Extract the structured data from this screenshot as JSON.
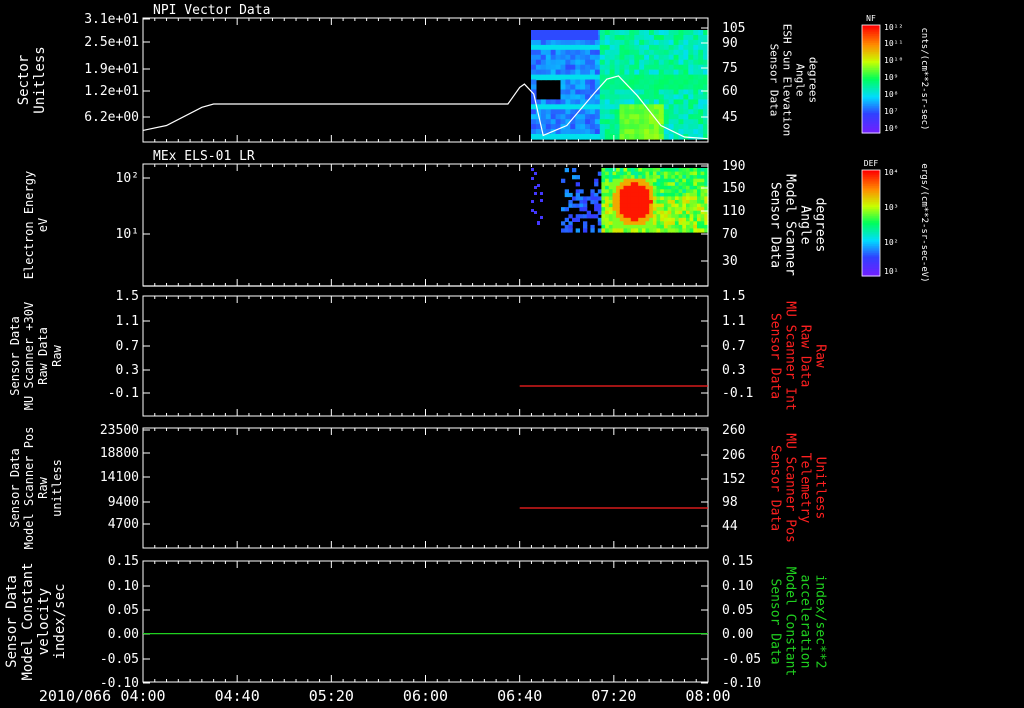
{
  "colors": {
    "background": "#000000",
    "axis": "#ffffff",
    "red": "#ff2020",
    "green": "#20d020"
  },
  "xaxis": {
    "date_label": "2010/066",
    "ticks": [
      "04:00",
      "04:40",
      "05:20",
      "06:00",
      "06:40",
      "07:20",
      "08:00"
    ]
  },
  "colorbars": [
    {
      "name": "NF",
      "top_label": "10¹²",
      "tick_labels": [
        "10¹¹",
        "10¹⁰",
        "10⁹",
        "10⁸",
        "10⁷",
        "10⁶"
      ],
      "units": "cnts/(cm**2-sr-sec)"
    },
    {
      "name": "DEF",
      "top_label": "10⁴",
      "tick_labels": [
        "10³",
        "10²",
        "10¹"
      ],
      "units": "ergs/(cm**2-sr-sec-eV)"
    }
  ],
  "chart_data": [
    {
      "type": "heatmap",
      "title": "NPI Vector Data",
      "ylabel": [
        "Sector",
        "Unitless"
      ],
      "ytick_labels": [
        "3.1e+01",
        "2.5e+01",
        "1.9e+01",
        "1.2e+01",
        "6.2e+00"
      ],
      "right_ylabel": [
        "Sensor Data",
        "ESH Sun Elevation",
        "Angle",
        "degrees"
      ],
      "right_ytick_labels": [
        "105",
        "90",
        "75",
        "60",
        "45"
      ],
      "right_ylim": [
        30,
        105
      ],
      "colorbar": "NF",
      "overlay_series": {
        "name": "ESH Sun Elevation Angle",
        "color": "#ffffff",
        "x": [
          "04:00",
          "04:10",
          "04:25",
          "04:30",
          "06:35",
          "06:40",
          "06:42",
          "06:46",
          "06:50",
          "07:00",
          "07:12",
          "07:17",
          "07:22",
          "07:30",
          "07:40",
          "07:50",
          "08:00"
        ],
        "y": [
          37,
          40,
          51,
          53,
          53,
          63,
          65,
          59,
          34,
          40,
          60,
          68,
          70,
          58,
          40,
          33,
          32
        ]
      }
    },
    {
      "type": "heatmap",
      "title": "MEx ELS-01 LR",
      "ylabel": [
        "Electron Energy",
        "eV"
      ],
      "ytick_labels": [
        "10²",
        "10¹"
      ],
      "ylog": true,
      "right_ylabel": [
        "Sensor Data",
        "Model Scanner",
        "Angle",
        "degrees"
      ],
      "right_ytick_labels": [
        "190",
        "150",
        "110",
        "70",
        "30"
      ],
      "right_ylim": [
        10,
        190
      ],
      "colorbar": "DEF",
      "overlay_series": {
        "name": "Model Scanner Angle",
        "color": "#ffffff",
        "x": [
          "04:00",
          "08:00"
        ],
        "y": [
          10,
          10
        ]
      }
    },
    {
      "type": "line",
      "ylabel": [
        "Sensor Data",
        "MU Scanner +30V",
        "Raw Data",
        "Raw"
      ],
      "ytick_labels": [
        "1.5",
        "1.1",
        "0.7",
        "0.3",
        "-0.1"
      ],
      "ylim": [
        -0.5,
        1.5
      ],
      "right_ylabel": [
        "Sensor Data",
        "MU Scanner Int",
        "Raw Data",
        "Raw"
      ],
      "right_ytick_labels": [
        "1.5",
        "1.1",
        "0.7",
        "0.3",
        "-0.1"
      ],
      "right_ylim": [
        -0.5,
        1.5
      ],
      "series": [
        {
          "color": "#ff2020",
          "axis": "right",
          "x": [
            "06:40",
            "08:00"
          ],
          "y": [
            0,
            0
          ]
        }
      ]
    },
    {
      "type": "line",
      "ylabel": [
        "Sensor Data",
        "Model Scanner Pos",
        "Raw",
        "unitless"
      ],
      "ytick_labels": [
        "23500",
        "18800",
        "14100",
        "9400",
        "4700"
      ],
      "ylim": [
        0,
        23500
      ],
      "right_ylabel": [
        "Sensor Data",
        "MU Scanner Pos",
        "Telemetry",
        "Unitless"
      ],
      "right_ytick_labels": [
        "260",
        "206",
        "152",
        "98",
        "44"
      ],
      "right_ylim": [
        -10,
        260
      ],
      "series": [
        {
          "color": "#ff2020",
          "axis": "right",
          "x": [
            "06:40",
            "08:00"
          ],
          "y": [
            80,
            80
          ]
        }
      ]
    },
    {
      "type": "line",
      "ylabel": [
        "Sensor Data",
        "Model Constant",
        "velocity",
        "index/sec"
      ],
      "ytick_labels": [
        "0.15",
        "0.10",
        "0.05",
        "0.00",
        "-0.05",
        "-0.10"
      ],
      "ylim": [
        -0.1,
        0.15
      ],
      "right_ylabel": [
        "Sensor Data",
        "Model Constant",
        "acceleration",
        "index/sec**2"
      ],
      "right_ytick_labels": [
        "0.15",
        "0.10",
        "0.05",
        "0.00",
        "-0.05",
        "-0.10"
      ],
      "right_ylim": [
        -0.1,
        0.15
      ],
      "series": [
        {
          "color": "#20d020",
          "axis": "right",
          "x": [
            "04:00",
            "08:00"
          ],
          "y": [
            0,
            0
          ]
        }
      ]
    }
  ]
}
